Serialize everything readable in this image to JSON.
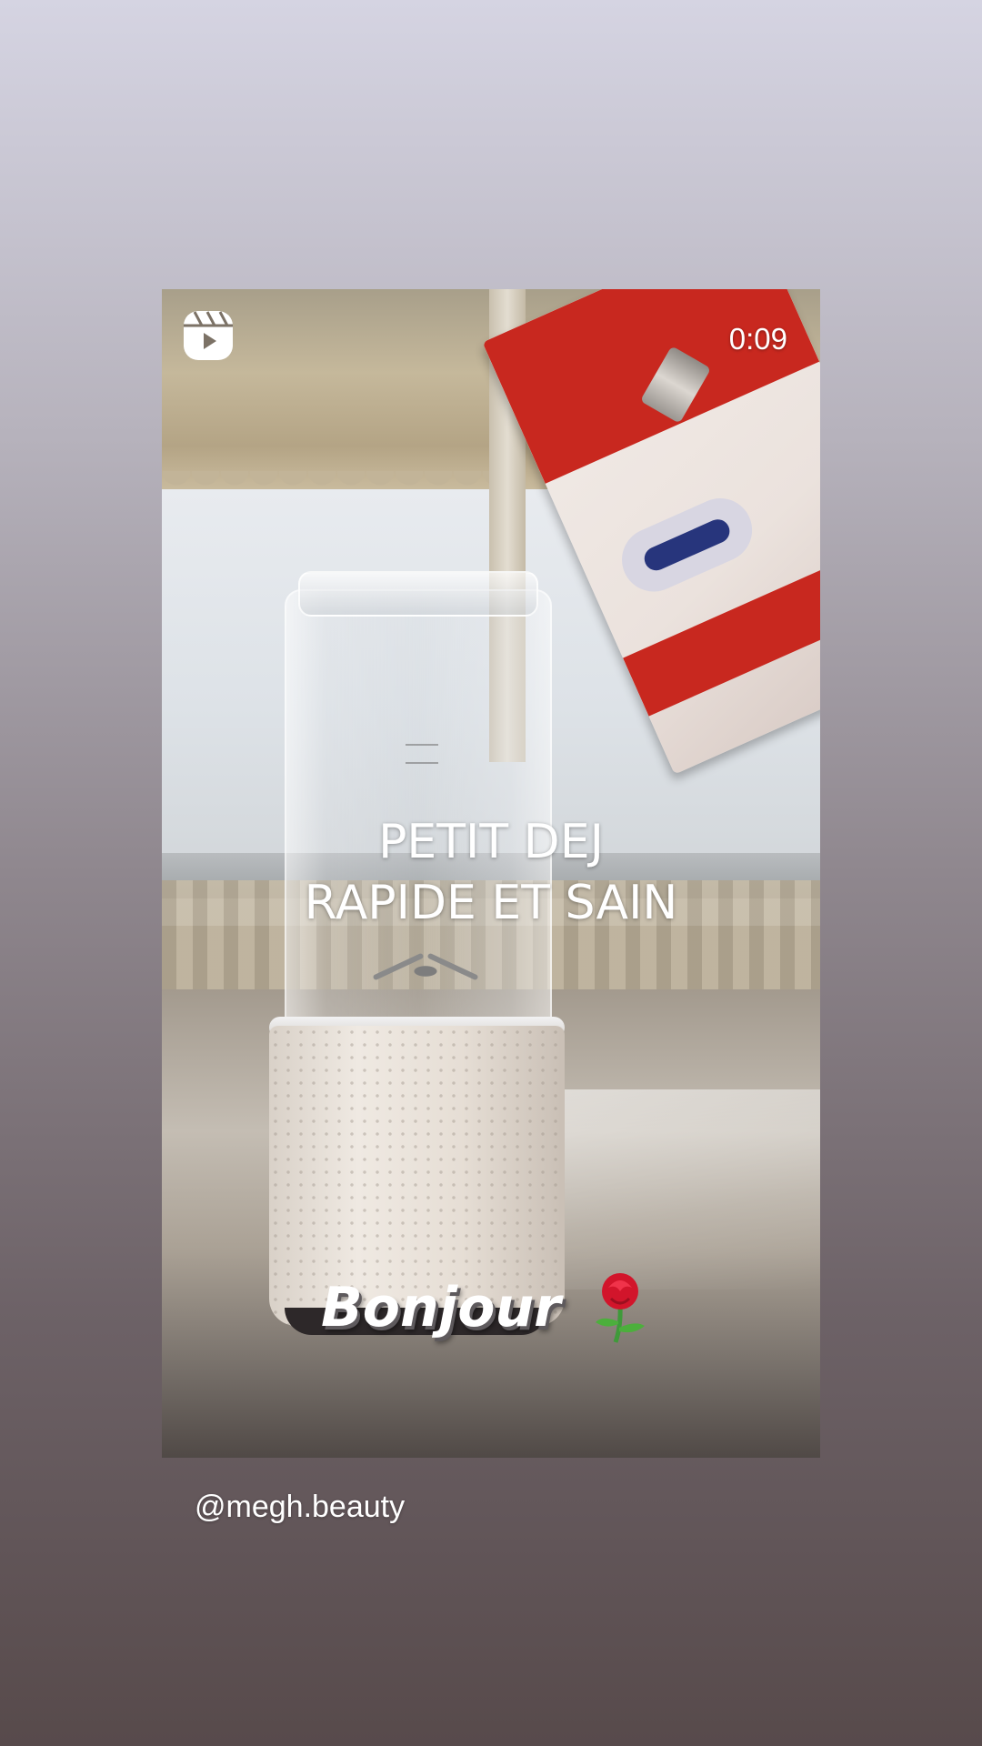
{
  "reel": {
    "duration": "0:09",
    "caption_line1": "PETIT DEJ",
    "caption_line2": "RAPIDE ET SAIN",
    "sticker_text": "Bonjour",
    "sticker_emoji": "rose-icon"
  },
  "author": {
    "username": "@megh.beauty"
  },
  "icons": {
    "reels": "reels-icon"
  },
  "colors": {
    "overlay_text": "#ffffff",
    "background_top": "#d5d4e2",
    "background_bottom": "#574a4b"
  }
}
